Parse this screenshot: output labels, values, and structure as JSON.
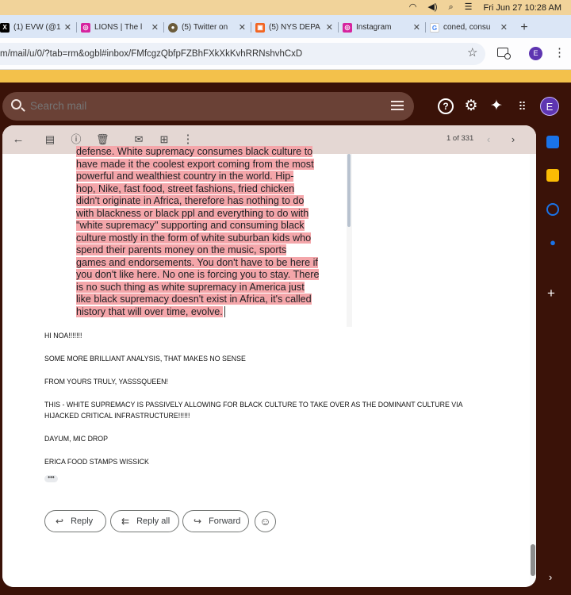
{
  "menubar": {
    "wifi_icon": "wifi-icon",
    "volume_icon": "volume-icon",
    "datetime": "Fri Jun 27  10:28 AM"
  },
  "tabs": [
    {
      "label": "(1) EVW (@1",
      "icon": "x-logo-icon",
      "color": "#000000"
    },
    {
      "label": "LIONS | The l",
      "icon": "instagram-icon",
      "color": "#d6249f"
    },
    {
      "label": "(5) Twitter on",
      "icon": "twitter-circle-icon",
      "color": "#6b5b3a"
    },
    {
      "label": "(5) NYS DEPA",
      "icon": "nys-icon",
      "color": "#f26522"
    },
    {
      "label": "Instagram",
      "icon": "instagram-icon",
      "color": "#d6249f"
    },
    {
      "label": "coned, consu",
      "icon": "google-icon",
      "color": "#4285f4"
    }
  ],
  "address_bar": {
    "url": "m/mail/u/0/?tab=rm&ogbl#inbox/FMfcgzQbfpFZBhFXkXkKvhRRNshvhCxD",
    "profile_initial": "E"
  },
  "gmail": {
    "search_placeholder": "Search mail",
    "avatar_initial": "E",
    "page_count": "1 of 331"
  },
  "quoted_lines": [
    "defense. White supremacy consumes black culture to",
    "have made it the coolest export coming from the most",
    "powerful and wealthiest country in the world. Hip-",
    "hop, Nike, fast food, street fashions, fried chicken",
    "didn't originate in Africa, therefore has nothing to do",
    "with blackness or black ppl and everything to do with",
    "\"white supremacy\" supporting and consuming black",
    "culture mostly in the form of white suburban kids who",
    "spend their parents money on the music, sports",
    "games and endorsements. You don't have to be here if",
    "you don't like here. No one is forcing you to stay. There",
    "is no such thing as white supremacy in America just",
    "like black supremacy doesn't exist in Africa, it's called",
    "history that will over time, evolve."
  ],
  "body_lines": {
    "l1": "HI NOA!!!!!!!",
    "l2": "SOME MORE BRILLIANT ANALYSIS, THAT MAKES NO SENSE",
    "l3": "FROM YOURS TRULY, YASSSQUEEN!",
    "l4a": "THIS - WHITE SUPREMACY IS PASSIVELY ALLOWING FOR BLACK CULTURE TO TAKE OVER AS THE DOMINANT CULTURE VIA",
    "l4b": "HIJACKED CRITICAL INFRASTRUCTURE!!!!!!",
    "l5": "DAYUM, MIC DROP",
    "l6": "ERICA FOOD STAMPS WISSICK",
    "ellipsis": "•••"
  },
  "actions": {
    "reply": "Reply",
    "reply_all": "Reply all",
    "forward": "Forward"
  },
  "colors": {
    "theme_bg": "#3a1208",
    "highlight": "#f4a6aa",
    "menubar": "#f1d39a",
    "accent_strip": "#f3c14b",
    "avatar": "#5e35b1"
  }
}
